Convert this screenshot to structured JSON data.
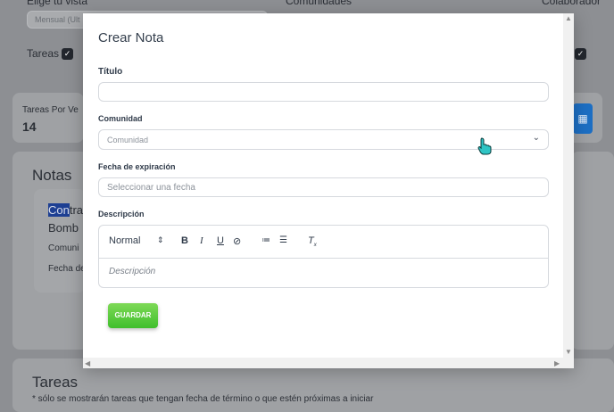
{
  "background": {
    "choose_view_label": "Elige tu vista",
    "view_value": "Mensual (Ult",
    "communities_label": "Comunidades",
    "collaborator_label": "Colaborador",
    "tasks_label": "Tareas",
    "tasks_week_label": "Tareas Por Ve",
    "tasks_week_count": "14",
    "notes_title": "Notas",
    "note_title_line1_hl": "Con",
    "note_title_line1_rest": "tra",
    "note_title_line2": "Bomb",
    "note_community_label": "Comuni",
    "note_date_label": "Fecha de",
    "tasks_section_title": "Tareas",
    "tasks_note": "* sólo se mostrarán tareas que tengan fecha de término o que estén próximas a iniciar"
  },
  "modal": {
    "title": "Crear Nota",
    "title_field_label": "Título",
    "title_value": "",
    "community_label": "Comunidad",
    "community_placeholder": "Comunidad",
    "expiration_label": "Fecha de expiración",
    "expiration_placeholder": "Seleccionar una fecha",
    "description_label": "Descripción",
    "format_select": "Normal",
    "description_placeholder": "Descripción",
    "save_label": "GUARDAR"
  }
}
